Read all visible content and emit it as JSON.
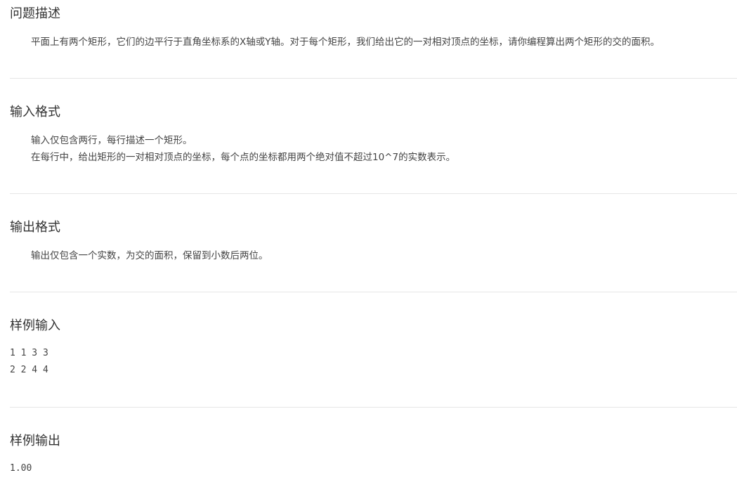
{
  "description": {
    "title": "问题描述",
    "text": "平面上有两个矩形，它们的边平行于直角坐标系的X轴或Y轴。对于每个矩形，我们给出它的一对相对顶点的坐标，请你编程算出两个矩形的交的面积。"
  },
  "input_format": {
    "title": "输入格式",
    "lines": [
      "输入仅包含两行，每行描述一个矩形。",
      "在每行中，给出矩形的一对相对顶点的坐标，每个点的坐标都用两个绝对值不超过10^7的实数表示。"
    ]
  },
  "output_format": {
    "title": "输出格式",
    "text": "输出仅包含一个实数，为交的面积，保留到小数后两位。"
  },
  "sample_input": {
    "title": "样例输入",
    "lines": [
      "1 1 3 3",
      "2 2 4 4"
    ]
  },
  "sample_output": {
    "title": "样例输出",
    "lines": [
      "1.00"
    ]
  }
}
